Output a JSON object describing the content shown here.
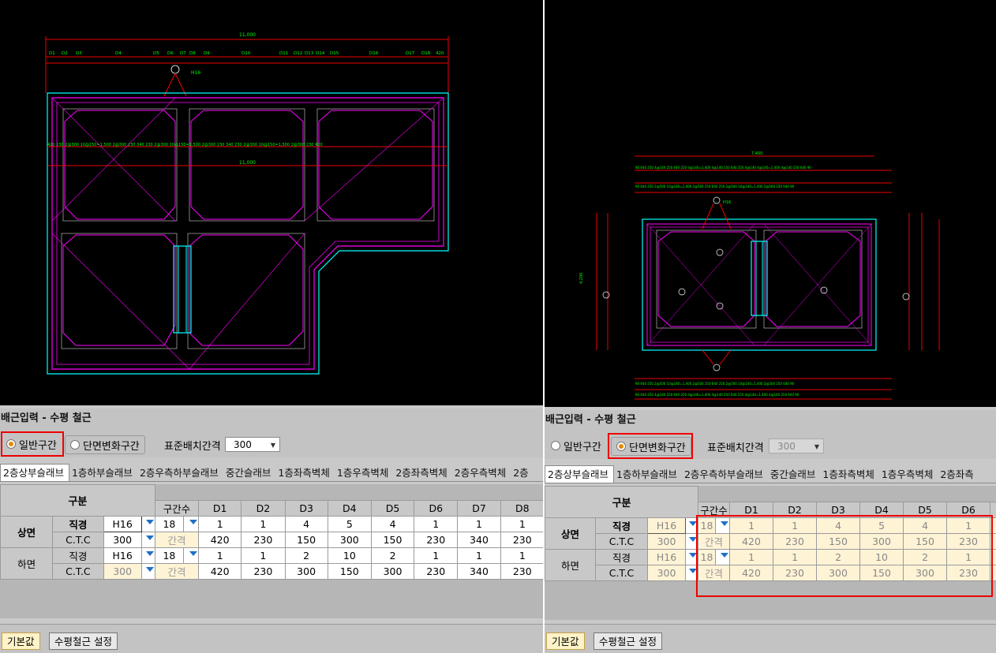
{
  "panel_title": "배근입력 - 수평 철근",
  "radio": {
    "general": "일반구간",
    "variable": "단면변화구간"
  },
  "standard_spacing": {
    "label": "표준배치간격",
    "value": "300"
  },
  "tabs_left": [
    "2층상부슬래브",
    "1층하부슬래브",
    "2층우측하부슬래브",
    "중간슬래브",
    "1층좌측벽체",
    "1층우측벽체",
    "2층좌측벽체",
    "2층우측벽체",
    "2층"
  ],
  "tabs_right": [
    "2층상부슬래브",
    "1층하부슬래브",
    "2층우측하부슬래브",
    "중간슬래브",
    "1층좌측벽체",
    "1층우측벽체",
    "2층좌측"
  ],
  "grid": {
    "category_header": "구분",
    "section_count_header": "구간수",
    "columns": [
      "D1",
      "D2",
      "D3",
      "D4",
      "D5",
      "D6",
      "D7",
      "D8"
    ],
    "top_face": "상면",
    "bottom_face": "하면",
    "row_label_dia": "직경",
    "row_label_ctc": "C.T.C",
    "spacing_label": "간격",
    "top_dia": "H16",
    "top_ctc": "300",
    "top_count": "18",
    "top_counts": [
      "1",
      "1",
      "4",
      "5",
      "4",
      "1",
      "1",
      "1"
    ],
    "top_spacings": [
      "420",
      "230",
      "150",
      "300",
      "150",
      "230",
      "340",
      "230"
    ],
    "bot_dia": "H16",
    "bot_ctc": "300",
    "bot_count": "18",
    "bot_counts": [
      "1",
      "1",
      "2",
      "10",
      "2",
      "1",
      "1",
      "1"
    ],
    "bot_spacings": [
      "420",
      "230",
      "300",
      "150",
      "300",
      "230",
      "340",
      "230"
    ]
  },
  "buttons": {
    "default": "기본값",
    "settings": "수평철근 설정"
  },
  "cad_left": {
    "dim_total": "11,000",
    "top_labels": [
      "D1",
      "D2",
      "D3",
      "D4",
      "D5",
      "D6",
      "D7",
      "D8",
      "D9",
      "D10",
      "D11",
      "D12",
      "D13",
      "D14",
      "D15",
      "D16",
      "D17",
      "D18",
      "420"
    ],
    "rebar_tag": "H16"
  },
  "cad_right": {
    "dim_total": "7,400",
    "rebar_tag": "H16",
    "side_height": "4,200"
  }
}
